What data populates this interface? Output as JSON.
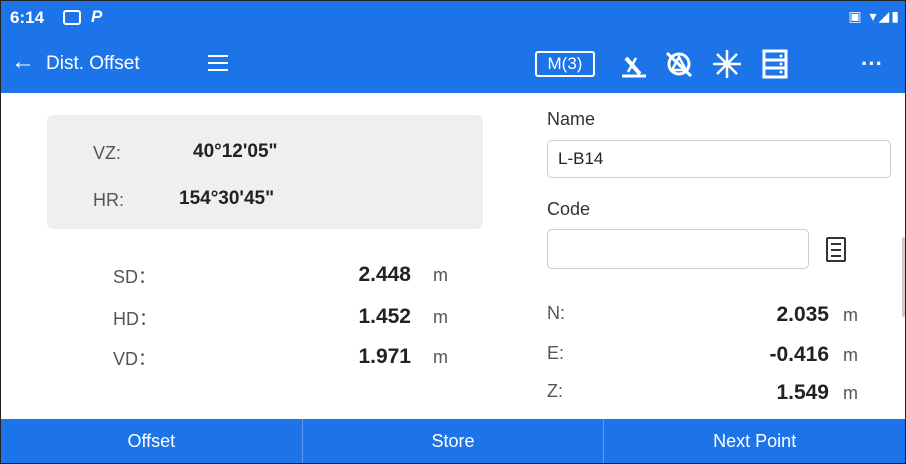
{
  "status": {
    "time": "6:14"
  },
  "appbar": {
    "title": "Dist. Offset",
    "memory_label": "M(3)",
    "icons": [
      "back-icon",
      "menu-icon",
      "laser-pointer-icon",
      "prism-off-icon",
      "laser-star-icon",
      "list-icon",
      "more-icon"
    ],
    "more": "···"
  },
  "angles": {
    "vz_label": "VZ:",
    "vz_value": "40°12'05\"",
    "hr_label": "HR:",
    "hr_value": "154°30'45\""
  },
  "measurements": [
    {
      "label": "SD：",
      "value": "2.448",
      "unit": "m"
    },
    {
      "label": "HD：",
      "value": "1.452",
      "unit": "m"
    },
    {
      "label": "VD：",
      "value": "1.971",
      "unit": "m"
    }
  ],
  "form": {
    "name_label": "Name",
    "name_value": "L-B14",
    "code_label": "Code",
    "code_value": ""
  },
  "coords": [
    {
      "label": "N:",
      "value": "2.035",
      "unit": "m"
    },
    {
      "label": "E:",
      "value": "-0.416",
      "unit": "m"
    },
    {
      "label": "Z:",
      "value": "1.549",
      "unit": "m"
    }
  ],
  "buttons": {
    "offset": "Offset",
    "store": "Store",
    "next": "Next Point"
  },
  "colors": {
    "primary": "#1c74e8",
    "panel": "#efefef"
  }
}
